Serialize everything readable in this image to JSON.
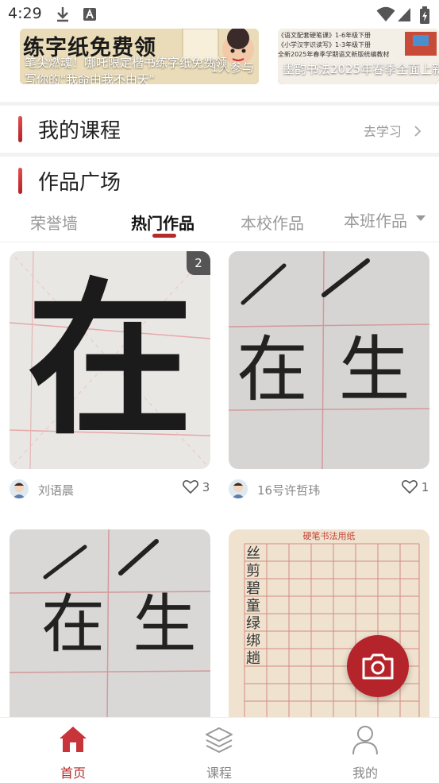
{
  "status_bar": {
    "time": "4:29"
  },
  "banners": [
    {
      "image_text": "练字纸免费领",
      "overlay_text": "笔尖燃魂！哪吒限定楷书练字纸免费领",
      "sub_text": "写你的\"我命由我不由天\"",
      "count_text": "1人参与"
    },
    {
      "overlay_text": "墨韵书法2025年春季全面上新",
      "image_lines": [
        "《语文配套硬笔课》1-6年级下册",
        "《小学汉字识读写》1-3年级下册",
        "全新2025年春季学期语文新版统编教材"
      ]
    }
  ],
  "my_courses": {
    "title": "我的课程",
    "link": "去学习",
    "link_icon": "chevron-right-icon"
  },
  "gallery": {
    "title": "作品广场",
    "tabs": [
      {
        "label": "荣誉墙",
        "active": false
      },
      {
        "label": "热门作品",
        "active": true
      },
      {
        "label": "本校作品",
        "active": false
      },
      {
        "label": "本班作品",
        "active": false,
        "has_dropdown": true
      }
    ],
    "works": [
      {
        "author": "刘语晨",
        "likes": "3",
        "badge": "2",
        "image_caption": "在"
      },
      {
        "author": "16号许哲玮",
        "likes": "1",
        "image_caption": "在 生"
      },
      {
        "image_caption": "在 生"
      },
      {
        "image_title": "硬笔书法用纸",
        "image_caption": "丝 剪 碧 童 绿 绑 趟"
      }
    ]
  },
  "camera_button": {
    "icon": "camera-icon"
  },
  "bottom_nav": [
    {
      "label": "首页",
      "icon": "home-icon",
      "active": true
    },
    {
      "label": "课程",
      "icon": "layers-icon",
      "active": false
    },
    {
      "label": "我的",
      "icon": "user-icon",
      "active": false
    }
  ],
  "colors": {
    "accent": "#b52a2a",
    "muted": "#999999"
  }
}
